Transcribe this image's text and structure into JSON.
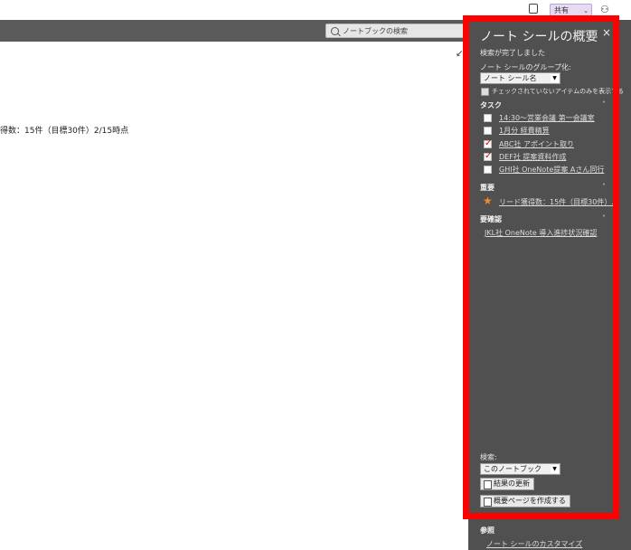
{
  "toolbar": {
    "search_placeholder": "ノートブックの検索",
    "share_label": "共有",
    "share_caret": "⌄"
  },
  "page": {
    "text_line": "得数：15件（目標30件）2/15時点"
  },
  "pane": {
    "title": "ノート シールの概要",
    "status": "検索が完了しました",
    "group_label": "ノート シールのグループ化:",
    "group_value": "ノート シール名",
    "unchecked_only_label": "チェックされていないアイテムのみを表示する",
    "sections": {
      "task": "タスク",
      "important": "重要",
      "confirm": "要確認"
    },
    "tasks": [
      {
        "label": "14:30～営業会議 第一会議室",
        "checked": false
      },
      {
        "label": "1月分 経費精算",
        "checked": false
      },
      {
        "label": "ABC社 アポイント取り",
        "checked": true
      },
      {
        "label": "DEF社 提案資料作成",
        "checked": true
      },
      {
        "label": "GHI社 OneNote提案 Aさん同行",
        "checked": false
      }
    ],
    "important_item": "リード獲得数：15件（目標30件）...",
    "confirm_item": "JKL社 OneNote 導入進捗状況確認",
    "search_label": "検索:",
    "search_scope": "このノートブック",
    "refresh_button": "結果の更新",
    "create_page_button": "概要ページを作成する",
    "reference_label": "参照",
    "customize_link": "ノート シールのカスタマイズ"
  },
  "colors": {
    "pane_bg": "#505050",
    "highlight": "#ff0000",
    "star": "#f28c28",
    "check_red": "#dd0000"
  }
}
